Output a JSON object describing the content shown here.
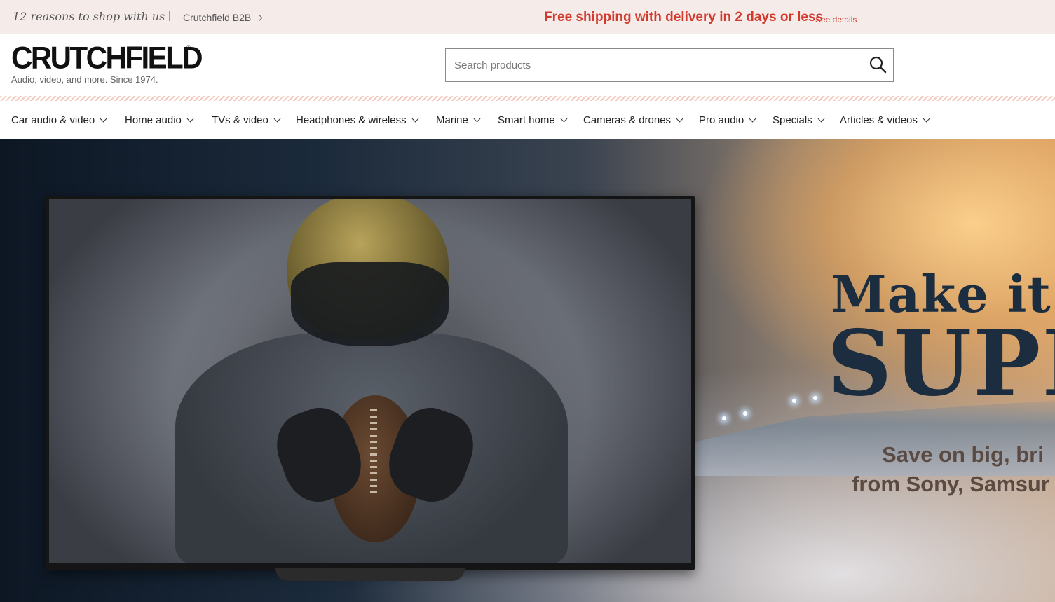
{
  "promo_bar": {
    "reasons_link": "12 reasons to shop with us",
    "separator": "|",
    "b2b_link": "Crutchfield B2B",
    "shipping_message": "Free shipping with delivery in 2 days or less",
    "see_details": "See details",
    "shipping_color": "#d23a2d"
  },
  "header": {
    "logo": "CRUTCHFIELD",
    "logo_mark": "®",
    "tagline": "Audio, video, and more. Since 1974.",
    "search": {
      "placeholder": "Search products",
      "value": "",
      "icon": "search-icon"
    }
  },
  "nav": {
    "items": [
      {
        "label": "Car audio & video"
      },
      {
        "label": "Home audio"
      },
      {
        "label": "TVs & video"
      },
      {
        "label": "Headphones & wireless"
      },
      {
        "label": "Marine"
      },
      {
        "label": "Smart home"
      },
      {
        "label": "Cameras & drones"
      },
      {
        "label": "Pro audio"
      },
      {
        "label": "Specials"
      },
      {
        "label": "Articles & videos"
      }
    ]
  },
  "hero": {
    "headline_1": "Make it",
    "headline_2": "SUPI",
    "subline_1": "Save on big, bri",
    "subline_2": "from Sony, Samsur",
    "headline_color": "#1c2d3f"
  }
}
